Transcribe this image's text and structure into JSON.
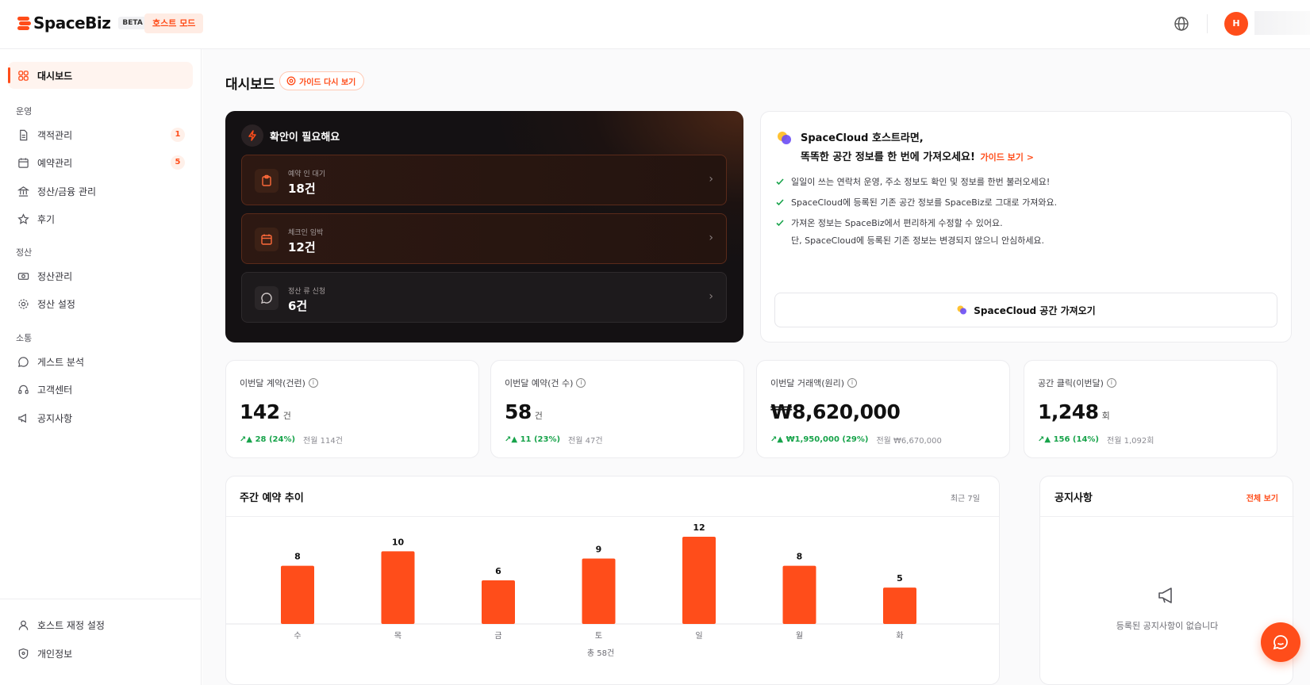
{
  "header": {
    "logo_text": "SpaceBiz",
    "beta_label": "BETA",
    "host_mode_label": "호스트 모드",
    "avatar_initial": "H"
  },
  "sidebar": {
    "dashboard": "대시보드",
    "sections": {
      "operation": "운영",
      "settlement": "정산",
      "communication": "소통"
    },
    "items": {
      "guest_mgmt": "객적관리",
      "guest_badge": "1",
      "booking_mgmt": "예약관리",
      "booking_badge": "5",
      "finance_mgmt": "정산/금융 관리",
      "reviews": "후기",
      "settle_mgmt": "정산관리",
      "settle_settings": "정산 설정",
      "guest_analysis": "게스트 분석",
      "customer_center": "고객센터",
      "notices": "공지사항",
      "host_account": "호스트 재정 설정",
      "privacy": "개인정보"
    }
  },
  "main": {
    "page_title": "대시보드",
    "guide_button": "가이드 다시 보기"
  },
  "action_card": {
    "title": "확안이 필요해요",
    "rows": [
      {
        "label": "예약 인 대기",
        "value": "18건"
      },
      {
        "label": "체크인 임박",
        "value": "12건"
      },
      {
        "label": "정산 류 신청",
        "value": "6건"
      }
    ]
  },
  "spacecloud": {
    "title_line1": "SpaceCloud 호스트라면,",
    "title_line2": "똑똑한 공간 정보를 한 번에 가져오세요!",
    "guide_link": "가이드 보기 >",
    "checks": [
      "일일이 쓰는 연락처 운영, 주소 정보도 확인 및 정보를 한번 불러오세요!",
      "SpaceCloud에 등록된 기존 공간 정보를 SpaceBiz로 그대로 가져와요.",
      "가져온 정보는 SpaceBiz에서 편리하게 수정할 수 있어요."
    ],
    "note": "단, SpaceCloud에 등록된 기존 정보는 변경되지 않으니 안심하세요.",
    "import_button": "SpaceCloud 공간 가져오기"
  },
  "stats": [
    {
      "label": "이번달 계약(건런)",
      "value": "142",
      "unit": "건",
      "change": "28 (24%)",
      "prev": "전월 114건"
    },
    {
      "label": "이번달 예약(건 수)",
      "value": "58",
      "unit": "건",
      "change": "11 (23%)",
      "prev": "전월 47건"
    },
    {
      "label": "이번달 거래액(원리)",
      "value": "₩8,620,000",
      "unit": "",
      "change": "₩1,950,000 (29%)",
      "prev": "전월 ₩6,670,000"
    },
    {
      "label": "공간 클릭(이번달)",
      "value": "1,248",
      "unit": "회",
      "change": "156 (14%)",
      "prev": "전월 1,092회"
    }
  ],
  "weekly": {
    "title": "주간 예약 추이",
    "range": "최근 7일",
    "total": "총 58건"
  },
  "chart_data": {
    "type": "bar",
    "title": "주간 예약 추이",
    "categories": [
      "수",
      "목",
      "금",
      "토",
      "일",
      "월",
      "화"
    ],
    "values": [
      8,
      10,
      6,
      9,
      12,
      8,
      5
    ],
    "ylim": [
      0,
      12
    ],
    "grid": false,
    "bar_color": "#ff4d1a"
  },
  "notice": {
    "title": "공지사항",
    "view_all": "전체 보기",
    "empty_text": "등록된 공지사항이 없습니다"
  },
  "colors": {
    "accent": "#ff4d1a",
    "positive": "#17a34a",
    "dark_card": "#141113"
  }
}
